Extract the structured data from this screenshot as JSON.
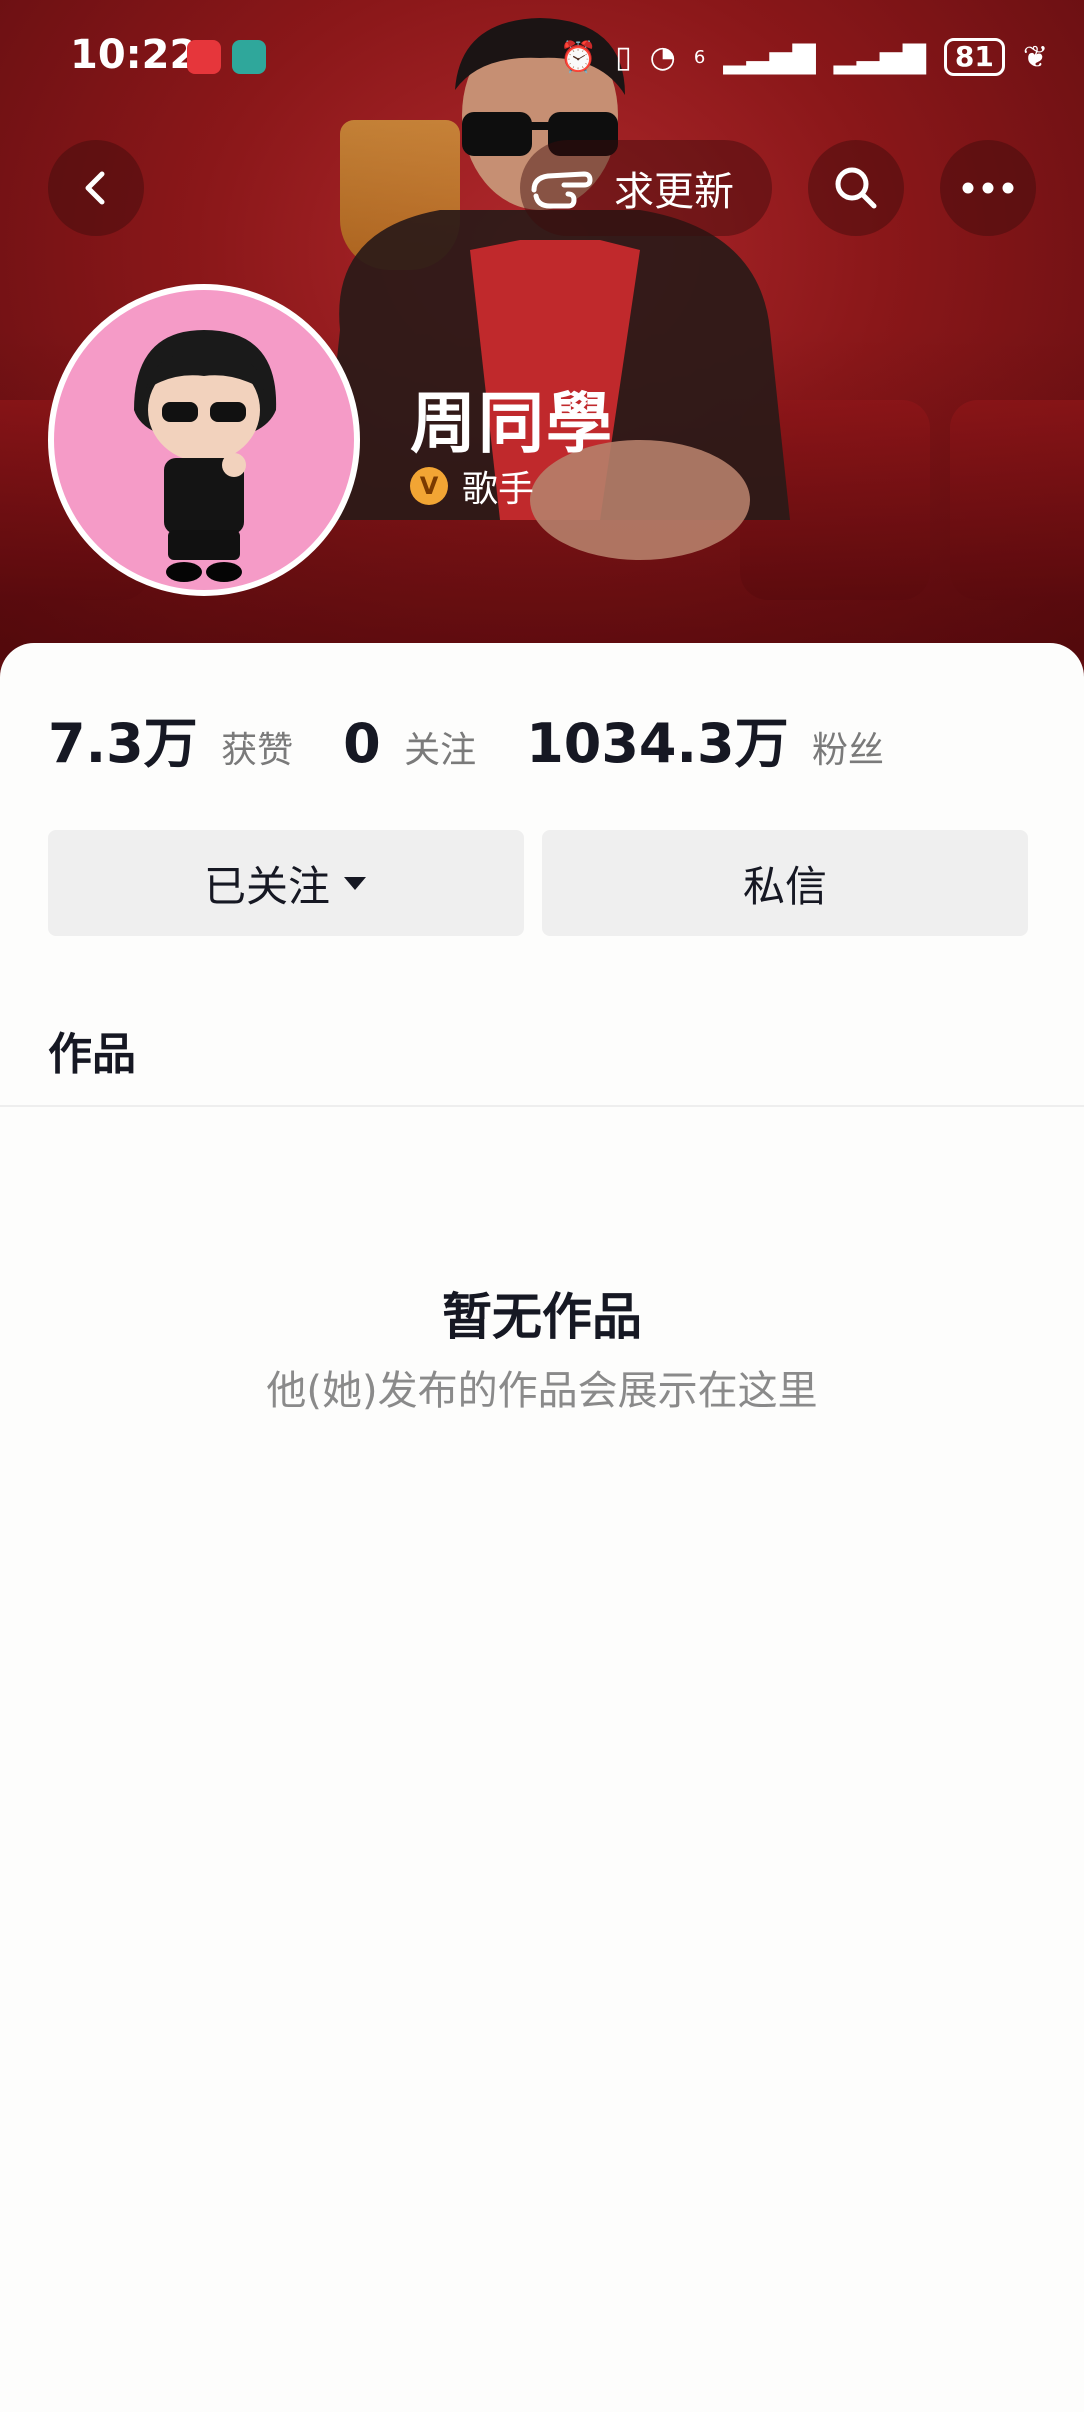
{
  "status_bar": {
    "time": "10:22",
    "app_icon_1": "huawei-app-icon",
    "app_icon_2": "boss-zhipin-app-icon",
    "network_label": "6",
    "battery": "81"
  },
  "toolbar": {
    "back_icon": "chevron-left-icon",
    "update_label": "求更新",
    "update_icon": "pointing-hand-icon",
    "search_icon": "search-icon",
    "more_icon": "more-horizontal-icon"
  },
  "profile": {
    "name": "周同學",
    "role_badge": "V",
    "role": "歌手"
  },
  "stats": {
    "likes_value": "7.3万",
    "likes_label": "获赞",
    "following_value": "0",
    "following_label": "关注",
    "followers_value": "1034.3万",
    "followers_label": "粉丝"
  },
  "actions": {
    "follow_label": "已关注",
    "message_label": "私信"
  },
  "tabs": {
    "works_label": "作品"
  },
  "empty_state": {
    "title": "暂无作品",
    "subtitle": "他(她)发布的作品会展示在这里"
  },
  "colors": {
    "header_red": "#8a1719",
    "avatar_bg": "#f59bc7",
    "button_bg": "#efefef",
    "text_primary": "#161823",
    "text_secondary": "#8a8a8a",
    "badge": "#f2a534"
  }
}
